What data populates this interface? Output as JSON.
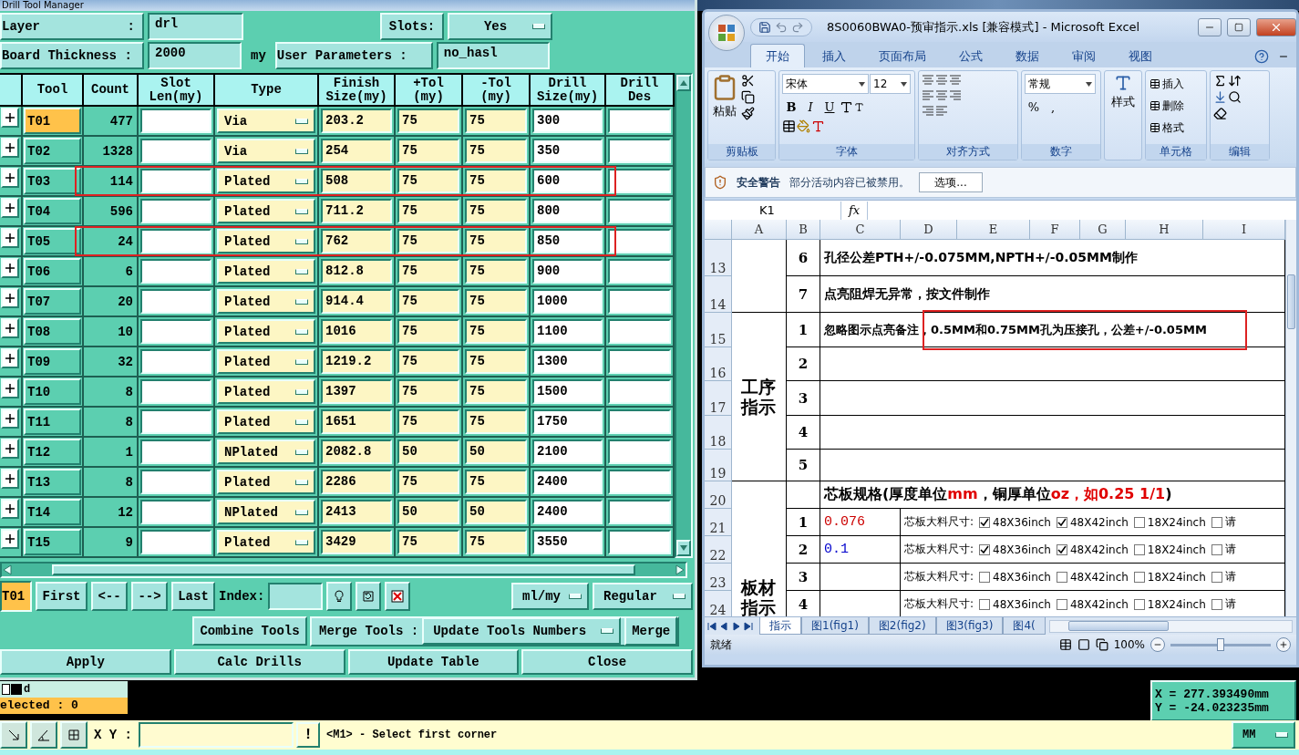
{
  "drill_window": {
    "title": "Drill Tool Manager",
    "layer": {
      "label": "Layer",
      "colon": ":",
      "value": "drl"
    },
    "slots": {
      "label": "Slots:",
      "value": "Yes"
    },
    "board_thickness": {
      "label": "Board Thickness :",
      "value": "2000",
      "unit": "my"
    },
    "user_parameters": {
      "label": "User Parameters :",
      "value": "no_hasl"
    },
    "columns": [
      "Tool",
      "Count",
      "Slot Len(my)",
      "Type",
      "Finish Size(my)",
      "+Tol (my)",
      "-Tol (my)",
      "Drill Size(my)",
      "Drill Des"
    ],
    "tool_rows": [
      {
        "tool": "T01",
        "count": "477",
        "type": "Via",
        "finish_size": "203.2",
        "plus_tol": "75",
        "minus_tol": "75",
        "drill_size": "300",
        "selected": true,
        "highlighted": false
      },
      {
        "tool": "T02",
        "count": "1328",
        "type": "Via",
        "finish_size": "254",
        "plus_tol": "75",
        "minus_tol": "75",
        "drill_size": "350",
        "selected": false,
        "highlighted": false
      },
      {
        "tool": "T03",
        "count": "114",
        "type": "Plated",
        "finish_size": "508",
        "plus_tol": "75",
        "minus_tol": "75",
        "drill_size": "600",
        "selected": false,
        "highlighted": true
      },
      {
        "tool": "T04",
        "count": "596",
        "type": "Plated",
        "finish_size": "711.2",
        "plus_tol": "75",
        "minus_tol": "75",
        "drill_size": "800",
        "selected": false,
        "highlighted": false
      },
      {
        "tool": "T05",
        "count": "24",
        "type": "Plated",
        "finish_size": "762",
        "plus_tol": "75",
        "minus_tol": "75",
        "drill_size": "850",
        "selected": false,
        "highlighted": true
      },
      {
        "tool": "T06",
        "count": "6",
        "type": "Plated",
        "finish_size": "812.8",
        "plus_tol": "75",
        "minus_tol": "75",
        "drill_size": "900",
        "selected": false,
        "highlighted": false
      },
      {
        "tool": "T07",
        "count": "20",
        "type": "Plated",
        "finish_size": "914.4",
        "plus_tol": "75",
        "minus_tol": "75",
        "drill_size": "1000",
        "selected": false,
        "highlighted": false
      },
      {
        "tool": "T08",
        "count": "10",
        "type": "Plated",
        "finish_size": "1016",
        "plus_tol": "75",
        "minus_tol": "75",
        "drill_size": "1100",
        "selected": false,
        "highlighted": false
      },
      {
        "tool": "T09",
        "count": "32",
        "type": "Plated",
        "finish_size": "1219.2",
        "plus_tol": "75",
        "minus_tol": "75",
        "drill_size": "1300",
        "selected": false,
        "highlighted": false
      },
      {
        "tool": "T10",
        "count": "8",
        "type": "Plated",
        "finish_size": "1397",
        "plus_tol": "75",
        "minus_tol": "75",
        "drill_size": "1500",
        "selected": false,
        "highlighted": false
      },
      {
        "tool": "T11",
        "count": "8",
        "type": "Plated",
        "finish_size": "1651",
        "plus_tol": "75",
        "minus_tol": "75",
        "drill_size": "1750",
        "selected": false,
        "highlighted": false
      },
      {
        "tool": "T12",
        "count": "1",
        "type": "NPlated",
        "finish_size": "2082.8",
        "plus_tol": "50",
        "minus_tol": "50",
        "drill_size": "2100",
        "selected": false,
        "highlighted": false
      },
      {
        "tool": "T13",
        "count": "8",
        "type": "Plated",
        "finish_size": "2286",
        "plus_tol": "75",
        "minus_tol": "75",
        "drill_size": "2400",
        "selected": false,
        "highlighted": false
      },
      {
        "tool": "T14",
        "count": "12",
        "type": "NPlated",
        "finish_size": "2413",
        "plus_tol": "50",
        "minus_tol": "50",
        "drill_size": "2400",
        "selected": false,
        "highlighted": false
      },
      {
        "tool": "T15",
        "count": "9",
        "type": "Plated",
        "finish_size": "3429",
        "plus_tol": "75",
        "minus_tol": "75",
        "drill_size": "3550",
        "selected": false,
        "highlighted": false
      }
    ],
    "current_tool": "T01",
    "nav_buttons": [
      "First",
      "<--",
      "-->",
      "Last"
    ],
    "index_label": "Index:",
    "units": "ml/my",
    "mode": "Regular",
    "combine_button": "Combine Tools",
    "merge_label": "Merge Tools :",
    "merge_option": "Update Tools Numbers",
    "merge_button": "Merge",
    "actions": [
      "Apply",
      "Calc Drills",
      "Update Table",
      "Close"
    ]
  },
  "excel": {
    "title": "8S0060BWA0-预审指示.xls  [兼容模式] - Microsoft Excel",
    "tabs": [
      {
        "label": "开始",
        "selected": true
      },
      {
        "label": "插入",
        "selected": false
      },
      {
        "label": "页面布局",
        "selected": false
      },
      {
        "label": "公式",
        "selected": false
      },
      {
        "label": "数据",
        "selected": false
      },
      {
        "label": "审阅",
        "selected": false
      },
      {
        "label": "视图",
        "selected": false
      }
    ],
    "clipboard": {
      "group": "剪贴板",
      "paste": "粘贴"
    },
    "font": {
      "group": "字体",
      "name": "宋体",
      "size": "12",
      "styles": [
        "B",
        "I",
        "U"
      ]
    },
    "alignment": {
      "group": "对齐方式"
    },
    "number": {
      "group": "数字",
      "format": "常规",
      "percent": "%",
      "comma": ","
    },
    "styles": {
      "label": "样式"
    },
    "cells": {
      "group": "单元格",
      "items": [
        "插入",
        "删除",
        "格式"
      ]
    },
    "editing": {
      "group": "编辑"
    },
    "security": {
      "title": "安全警告",
      "message": "部分活动内容已被禁用。",
      "button": "选项..."
    },
    "name_box": "K1",
    "function_label": "fx",
    "sheet": {
      "columns": [
        "A",
        "B",
        "C",
        "D",
        "E",
        "F",
        "G",
        "H",
        "I"
      ],
      "row_numbers": [
        "13",
        "14",
        "15",
        "16",
        "17",
        "18",
        "19",
        "20",
        "21",
        "22",
        "23",
        "24"
      ],
      "note_rows": [
        {
          "number": "6",
          "text": "孔径公差PTH+/-0.075MM,NPTH+/-0.05MM制作"
        },
        {
          "number": "7",
          "text": "点亮阻焊无异常，按文件制作"
        }
      ],
      "process": {
        "label": "工序指示",
        "rows": [
          {
            "number": "1",
            "text": "忽略图示点亮备注，0.5MM和0.75MM孔为压接孔，公差+/-0.05MM",
            "highlighted": true
          },
          {
            "number": "2",
            "highlighted": false
          },
          {
            "number": "3",
            "highlighted": false
          },
          {
            "number": "4",
            "highlighted": false
          },
          {
            "number": "5",
            "highlighted": false
          }
        ]
      },
      "material": {
        "label": "板材指示",
        "heading": [
          {
            "text": "芯板规格(厚度单位",
            "emphasis": false
          },
          {
            "text": "mm",
            "emphasis": true
          },
          {
            "text": "，铜厚单位",
            "emphasis": false
          },
          {
            "text": "oz，如0.25 1/1",
            "emphasis": true
          },
          {
            "text": ")",
            "emphasis": false
          }
        ],
        "rows": [
          {
            "number": "1",
            "value": "0.076",
            "color": "#cc0000",
            "size_label": "芯板大料尺寸:",
            "options": [
              {
                "label": "48X36inch",
                "checked": true
              },
              {
                "label": "48X42inch",
                "checked": true
              },
              {
                "label": "18X24inch",
                "checked": false
              },
              {
                "label": "请",
                "checked": false
              }
            ]
          },
          {
            "number": "2",
            "value": "0.1",
            "color": "#0000cc",
            "size_label": "芯板大料尺寸:",
            "options": [
              {
                "label": "48X36inch",
                "checked": true
              },
              {
                "label": "48X42inch",
                "checked": true
              },
              {
                "label": "18X24inch",
                "checked": false
              },
              {
                "label": "请",
                "checked": false
              }
            ]
          },
          {
            "number": "3",
            "size_label": "芯板大料尺寸:",
            "options": [
              {
                "label": "48X36inch",
                "checked": false
              },
              {
                "label": "48X42inch",
                "checked": false
              },
              {
                "label": "18X24inch",
                "checked": false
              },
              {
                "label": "请",
                "checked": false
              }
            ]
          },
          {
            "number": "4",
            "size_label": "芯板大料尺寸:",
            "options": [
              {
                "label": "48X36inch",
                "checked": false
              },
              {
                "label": "48X42inch",
                "checked": false
              },
              {
                "label": "18X24inch",
                "checked": false
              },
              {
                "label": "请",
                "checked": false
              }
            ]
          }
        ]
      }
    },
    "sheet_tabs": [
      {
        "label": "指示",
        "selected": true
      },
      {
        "label": "图1(fig1)",
        "selected": false
      },
      {
        "label": "图2(fig2)",
        "selected": false
      },
      {
        "label": "图3(fig3)",
        "selected": false
      },
      {
        "label": "图4(",
        "selected": false
      }
    ],
    "status": "就绪",
    "zoom": {
      "label": "100%",
      "level": 0.5
    }
  },
  "layer_panel": {
    "layer": "d",
    "selected": "elected : 0"
  },
  "coordinates": {
    "x": "X = 277.393490mm",
    "y": "Y = -24.023235mm"
  },
  "command_bar": {
    "xy_label": "X Y :",
    "alert": "!",
    "message": "<M1> - Select first corner",
    "units": "MM"
  }
}
